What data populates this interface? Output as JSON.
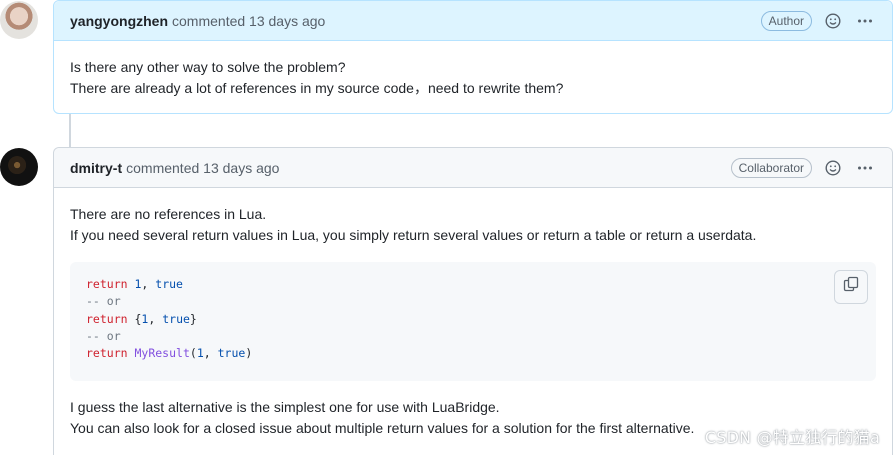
{
  "comments": [
    {
      "author": "yangyongzhen",
      "meta": "commented 13 days ago",
      "badge": "Author",
      "lines": [
        "Is there any other way to solve the problem?",
        "There are already a lot of references in my source code，need to rewrite them?"
      ]
    },
    {
      "author": "dmitry-t",
      "meta": "commented 13 days ago",
      "badge": "Collaborator",
      "lines": [
        "There are no references in Lua.",
        "If you need several return values in Lua, you simply return several values or return a table or return a userdata."
      ],
      "code": [
        {
          "kw": "return",
          "rest_num": "1",
          "sep": ", ",
          "val": "true"
        },
        {
          "comment": "-- or"
        },
        {
          "kw": "return",
          "open": "{",
          "rest_num": "1",
          "sep": ", ",
          "val": "true",
          "close": "}"
        },
        {
          "comment": "-- or"
        },
        {
          "kw": "return",
          "fn": "MyResult",
          "open": "(",
          "rest_num": "1",
          "sep": ", ",
          "val": "true",
          "close": ")"
        }
      ],
      "after_lines": [
        "I guess the last alternative is the simplest one for use with LuaBridge.",
        "You can also look for a closed issue about multiple return values for a solution for the first alternative."
      ]
    }
  ],
  "watermark": "CSDN @特立独行的猫a",
  "icons": {
    "emoji": "smiley-icon",
    "more": "kebab-horizontal-icon",
    "copy": "copy-icon"
  }
}
